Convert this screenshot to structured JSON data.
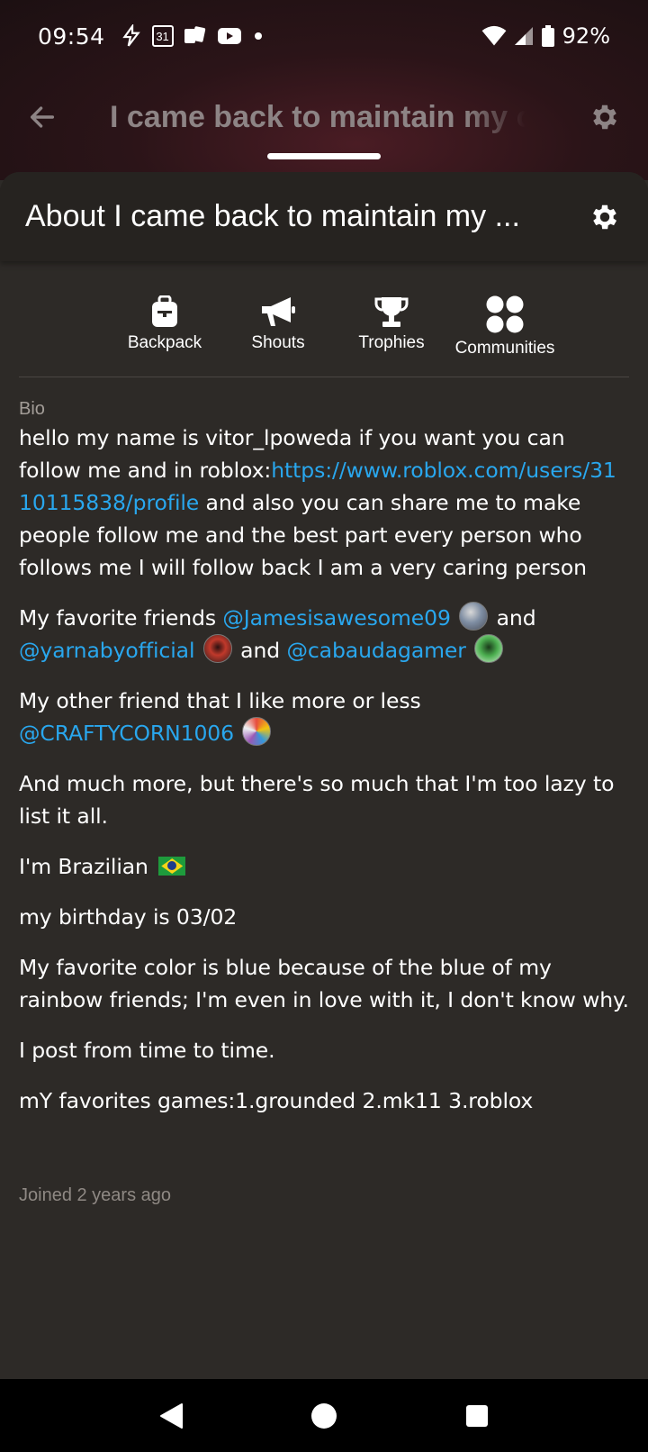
{
  "status_bar": {
    "time": "09:54",
    "calendar_day": "31",
    "battery": "92%"
  },
  "top_bar": {
    "title": "I came back to maintain my o"
  },
  "sheet": {
    "title": "About I came back to maintain my ..."
  },
  "tabs": [
    {
      "label": "Backpack",
      "icon": "backpack-icon"
    },
    {
      "label": "Shouts",
      "icon": "megaphone-icon"
    },
    {
      "label": "Trophies",
      "icon": "trophy-icon"
    },
    {
      "label": "Communities",
      "icon": "communities-icon"
    }
  ],
  "bio": {
    "label": "Bio",
    "p1_text": "hello my name is vitor_lpoweda if you want you can follow me and in roblox:",
    "p1_link": "https://www.roblox.com/users/3110115838/profile",
    "p1_rest": " and also you can share me to make people follow me and the best part every person who follows me I will follow back I am a very caring person",
    "p2_text": "My favorite friends ",
    "p2_mention1": "@Jamesisawesome09",
    "p2_and1": " and",
    "p2_mention2": "@yarnabyofficial",
    "p2_and2": " and ",
    "p2_mention3": "@cabaudagamer",
    "p3_text": "My other friend that I like more or less",
    "p3_mention": "@CRAFTYCORN1006",
    "p4": "And much more, but there's so much that I'm too lazy to list it all.",
    "p5": "I'm Brazilian",
    "p6": "my birthday is 03/02",
    "p7": "My favorite color is blue because of the blue of my rainbow friends; I'm even in love with it, I don't know why.",
    "p8": "I post from time to time.",
    "p9": "mY favorites games:1.grounded 2.mk11 3.roblox"
  },
  "joined": "Joined 2 years ago",
  "colors": {
    "link": "#29a7ee",
    "background": "#2d2a27",
    "header": "#262320"
  }
}
